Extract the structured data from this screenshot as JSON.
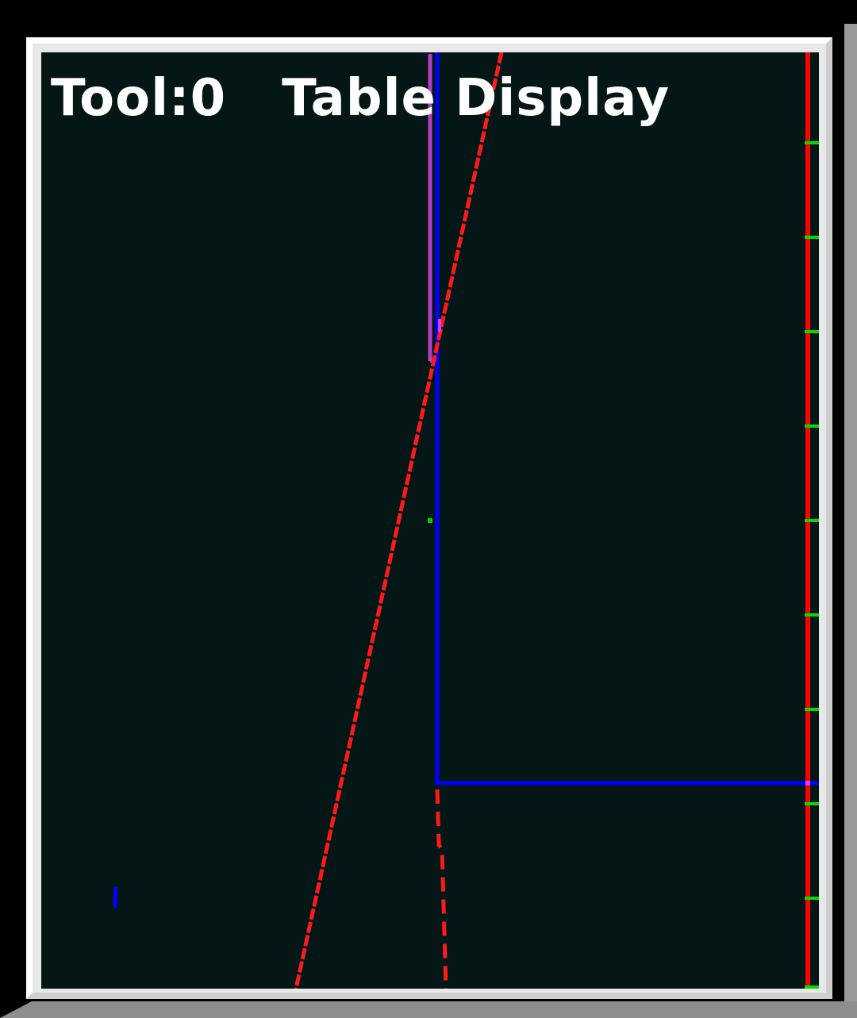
{
  "viewport": {
    "tool_label": "Tool:0",
    "display_label": "Table Display"
  },
  "colors": {
    "background": "#041616",
    "frame_light": "#ffffff",
    "frame_shadow": "#cfcfcf",
    "text": "#ffffff",
    "toolpath_blue": "#0000ff",
    "toolpath_red": "#ff0000",
    "tool_magenta": "#b040c0",
    "tick_green": "#00ff00"
  },
  "icons": {
    "tool_marker": "magenta-tool-icon",
    "origin_marker": "blue-origin-icon"
  }
}
